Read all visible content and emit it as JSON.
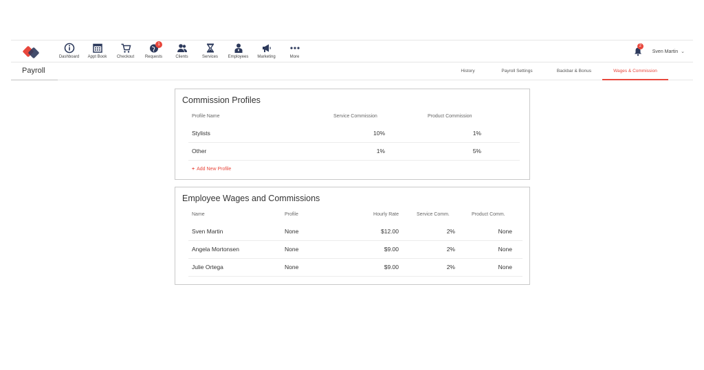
{
  "nav": {
    "items": [
      {
        "label": "Dashboard",
        "icon": "info-circle-icon"
      },
      {
        "label": "Appt Book",
        "icon": "calendar-icon"
      },
      {
        "label": "Checkout",
        "icon": "cart-icon"
      },
      {
        "label": "Requests",
        "icon": "globe-icon",
        "badge": "1"
      },
      {
        "label": "Clients",
        "icon": "clients-icon"
      },
      {
        "label": "Services",
        "icon": "hourglass-icon"
      },
      {
        "label": "Employees",
        "icon": "employee-icon"
      },
      {
        "label": "Marketing",
        "icon": "megaphone-icon"
      },
      {
        "label": "More",
        "icon": "more-dots-icon"
      }
    ],
    "notifications_badge": "2",
    "user_name": "Sven Martin"
  },
  "page": {
    "title": "Payroll",
    "tabs": [
      "History",
      "Payroll Settings",
      "Backbar & Bonus",
      "Wages & Commission"
    ],
    "active_tab": "Wages & Commission"
  },
  "commission_profiles": {
    "title": "Commission Profiles",
    "headers": {
      "name": "Profile Name",
      "service": "Service Commission",
      "product": "Product Commission"
    },
    "rows": [
      {
        "name": "Stylists",
        "service": "10%",
        "product": "1%"
      },
      {
        "name": "Other",
        "service": "1%",
        "product": "5%"
      }
    ],
    "add_label": "Add New Profile"
  },
  "employee_wages": {
    "title": "Employee Wages and Commissions",
    "headers": {
      "name": "Name",
      "profile": "Profile",
      "rate": "Hourly Rate",
      "service": "Service Comm.",
      "product": "Product Comm."
    },
    "rows": [
      {
        "name": "Sven Martin",
        "profile": "None",
        "rate": "$12.00",
        "service": "2%",
        "product": "None"
      },
      {
        "name": "Angela Mortonsen",
        "profile": "None",
        "rate": "$9.00",
        "service": "2%",
        "product": "None"
      },
      {
        "name": "Julie Ortega",
        "profile": "None",
        "rate": "$9.00",
        "service": "2%",
        "product": "None"
      }
    ]
  },
  "colors": {
    "accent": "#e8473c",
    "brand_dark": "#2d3a5c",
    "icon": "#2d3a5c"
  }
}
